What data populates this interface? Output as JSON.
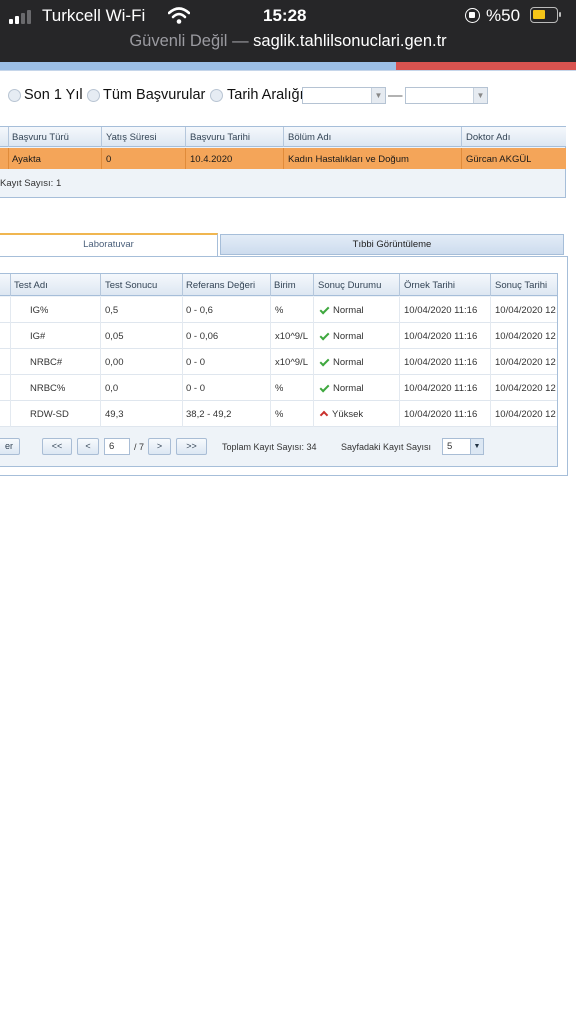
{
  "status_bar": {
    "carrier": "Turkcell Wi-Fi",
    "time": "15:28",
    "battery_percent": "%50",
    "battery_level": 0.5
  },
  "browser": {
    "security": "Güvenli Değil",
    "separator": "—",
    "domain": "saglik.tahlilsonuclari.gen.tr"
  },
  "filters": {
    "options": [
      "Son 1 Yıl",
      "Tüm Başvurular",
      "Tarih Aralığı"
    ],
    "range_separator": "—"
  },
  "applications": {
    "columns": [
      "Başvuru Türü",
      "Yatış Süresi",
      "Başvuru Tarihi",
      "Bölüm Adı",
      "Doktor Adı"
    ],
    "rows": [
      [
        "Ayakta",
        "0",
        "10.4.2020",
        "Kadın Hastalıkları ve Doğum",
        "Gürcan AKGÜL"
      ]
    ],
    "footer": "Kayıt Sayısı: 1"
  },
  "tabs": [
    "Laboratuvar",
    "Tıbbi Görüntüleme"
  ],
  "lab_results": {
    "columns": [
      "Test Adı",
      "Test Sonucu",
      "Referans Değeri",
      "Birim",
      "Sonuç Durumu",
      "Örnek Tarihi",
      "Sonuç Tarihi"
    ],
    "rows": [
      {
        "name": "IG%",
        "result": "0,5",
        "reference": "0 - 0,6",
        "unit": "%",
        "status": "Normal",
        "status_icon": "check-icon",
        "sample_date": "10/04/2020 11:16",
        "result_date": "10/04/2020 12"
      },
      {
        "name": "IG#",
        "result": "0,05",
        "reference": "0 - 0,06",
        "unit": "x10^9/L",
        "status": "Normal",
        "status_icon": "check-icon",
        "sample_date": "10/04/2020 11:16",
        "result_date": "10/04/2020 12"
      },
      {
        "name": "NRBC#",
        "result": "0,00",
        "reference": "0 - 0",
        "unit": "x10^9/L",
        "status": "Normal",
        "status_icon": "check-icon",
        "sample_date": "10/04/2020 11:16",
        "result_date": "10/04/2020 12"
      },
      {
        "name": "NRBC%",
        "result": "0,0",
        "reference": "0 - 0",
        "unit": "%",
        "status": "Normal",
        "status_icon": "check-icon",
        "sample_date": "10/04/2020 11:16",
        "result_date": "10/04/2020 12"
      },
      {
        "name": "RDW-SD",
        "result": "49,3",
        "reference": "38,2 - 49,2",
        "unit": "%",
        "status": "Yüksek",
        "status_icon": "arrow-up-icon",
        "sample_date": "10/04/2020 11:16",
        "result_date": "10/04/2020 12"
      }
    ]
  },
  "pager": {
    "left_button": "er",
    "first": "<<",
    "prev": "<",
    "current_page": "6",
    "total_pages": "/ 7",
    "next": ">",
    "last": ">>",
    "total_records": "Toplam Kayıt Sayısı: 34",
    "page_size_label": "Sayfadaki Kayıt Sayısı",
    "page_size": "5"
  },
  "colors": {
    "selected_row": "#f4a559",
    "header_blue": "#dde7f2",
    "active_tab_border": "#f0b650",
    "status_ok": "#3fa83f",
    "status_high": "#c9302c"
  }
}
